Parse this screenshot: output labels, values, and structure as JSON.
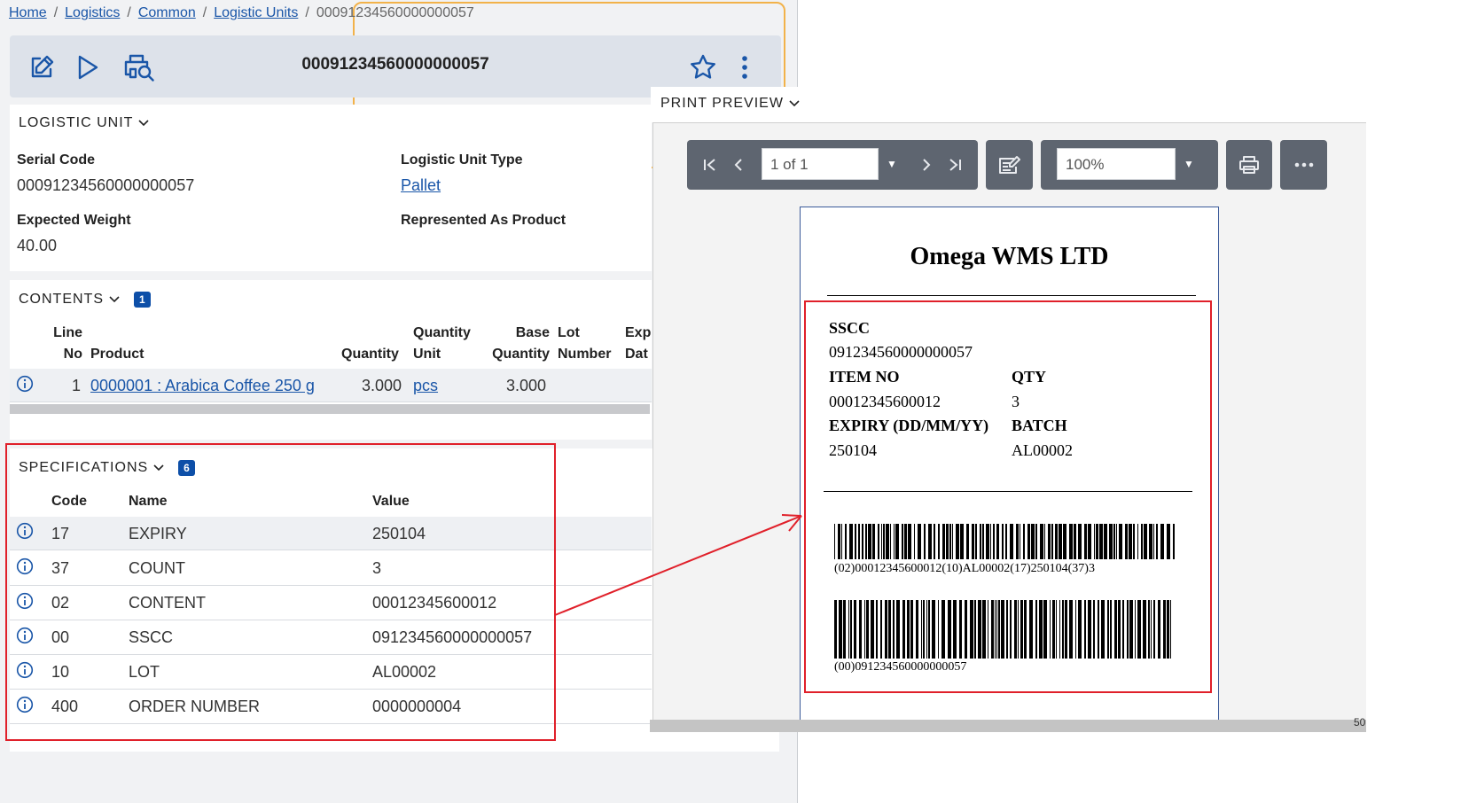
{
  "breadcrumb": {
    "items": [
      "Home",
      "Logistics",
      "Common",
      "Logistic Units"
    ],
    "current": "00091234560000000057",
    "separator": "/"
  },
  "toolbar": {
    "title": "00091234560000000057",
    "icons": [
      "edit-icon",
      "play-icon",
      "print-preview-icon",
      "star-icon",
      "more-vertical-icon"
    ]
  },
  "logistic_unit": {
    "section_title": "LOGISTIC UNIT",
    "serial_code_label": "Serial Code",
    "serial_code_value": "00091234560000000057",
    "type_label": "Logistic Unit Type",
    "type_value": "Pallet",
    "weight_label": "Expected Weight",
    "weight_value": "40.00",
    "product_label": "Represented As Product"
  },
  "contents": {
    "section_title": "CONTENTS",
    "count": "1",
    "headers": {
      "line_no_1": "Line",
      "line_no_2": "No",
      "product": "Product",
      "quantity": "Quantity",
      "qty_unit_1": "Quantity",
      "qty_unit_2": "Unit",
      "base_qty_1": "Base",
      "base_qty_2": "Quantity",
      "lot_1": "Lot",
      "lot_2": "Number",
      "exp_1": "Exp",
      "exp_2": "Dat"
    },
    "rows": [
      {
        "line_no": "1",
        "product": "0000001 : Arabica Coffee 250 g",
        "quantity": "3.000",
        "unit": "pcs",
        "base_quantity": "3.000"
      }
    ]
  },
  "specifications": {
    "section_title": "SPECIFICATIONS",
    "count": "6",
    "headers": {
      "code": "Code",
      "name": "Name",
      "value": "Value"
    },
    "rows": [
      {
        "code": "17",
        "name": "EXPIRY",
        "value": "250104"
      },
      {
        "code": "37",
        "name": "COUNT",
        "value": "3"
      },
      {
        "code": "02",
        "name": "CONTENT",
        "value": "00012345600012"
      },
      {
        "code": "00",
        "name": "SSCC",
        "value": "091234560000000057"
      },
      {
        "code": "10",
        "name": "LOT",
        "value": "AL00002"
      },
      {
        "code": "400",
        "name": "ORDER NUMBER",
        "value": "0000000004"
      }
    ]
  },
  "print_preview": {
    "title": "PRINT PREVIEW",
    "page_value": "1 of 1",
    "zoom_value": "100%",
    "scroll_text": "50",
    "label": {
      "company": "Omega WMS LTD",
      "sscc_label": "SSCC",
      "sscc_value": "091234560000000057",
      "item_no_label": "ITEM NO",
      "item_no_value": "00012345600012",
      "qty_label": "QTY",
      "qty_value": "3",
      "expiry_label": "EXPIRY (DD/MM/YY)",
      "expiry_value": "250104",
      "batch_label": "BATCH",
      "batch_value": "AL00002",
      "barcode1_text": "(02)00012345600012(10)AL00002(17)250104(37)3",
      "barcode2_text": "(00)091234560000000057"
    }
  },
  "colors": {
    "accent": "#0d4fa8",
    "link": "#1a56a8",
    "highlight_red": "#e0202a",
    "toolbar_bg": "#dde2ea",
    "report_toolbar_bg": "#5e6570"
  }
}
